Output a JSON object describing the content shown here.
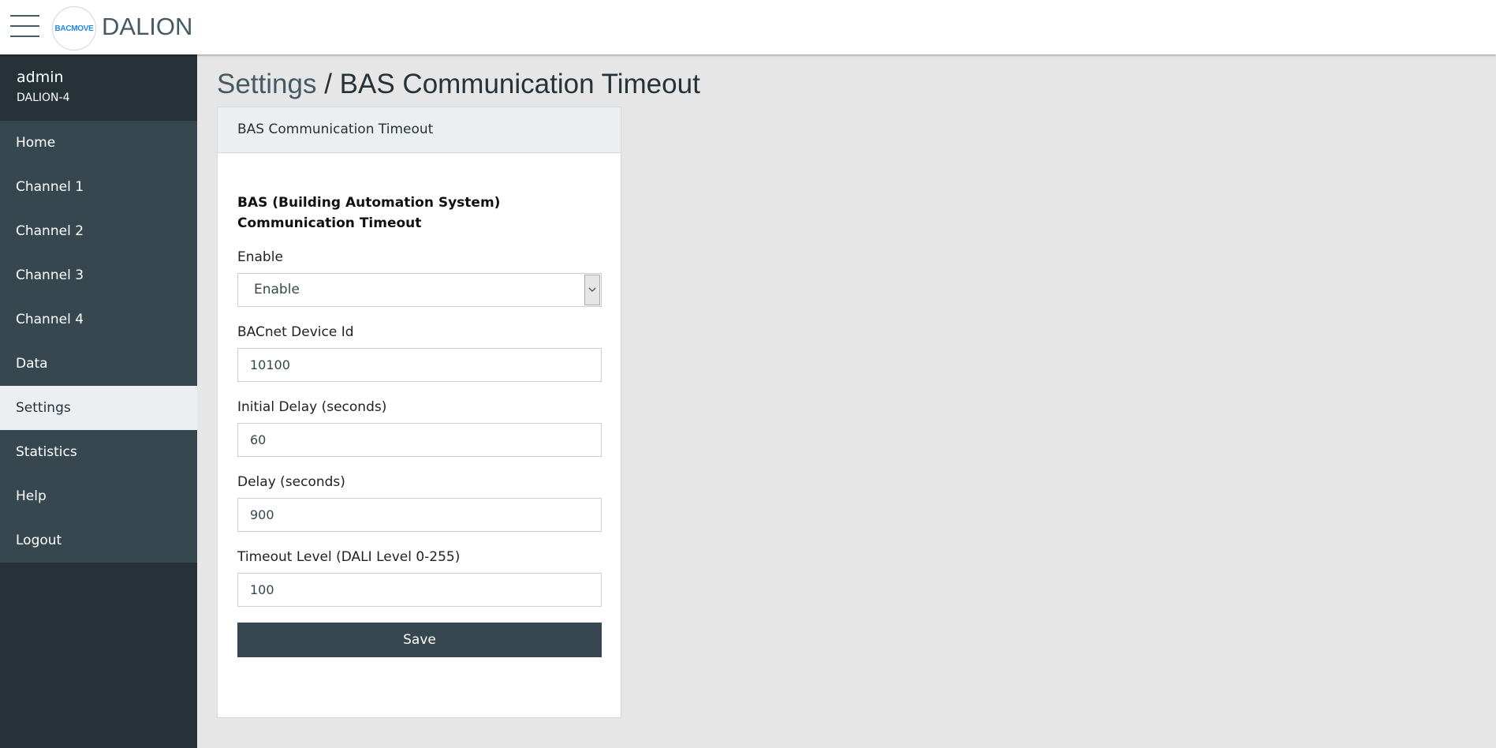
{
  "header": {
    "logo_text": "BACMOVE",
    "brand": "DALION"
  },
  "sidebar": {
    "user": "admin",
    "device": "DALION-4",
    "items": [
      {
        "label": "Home"
      },
      {
        "label": "Channel 1"
      },
      {
        "label": "Channel 2"
      },
      {
        "label": "Channel 3"
      },
      {
        "label": "Channel 4"
      },
      {
        "label": "Data"
      },
      {
        "label": "Settings"
      },
      {
        "label": "Statistics"
      },
      {
        "label": "Help"
      },
      {
        "label": "Logout"
      }
    ],
    "active_item": "Settings"
  },
  "page": {
    "breadcrumb": "Settings",
    "separator": " / ",
    "title": "BAS Communication Timeout"
  },
  "card": {
    "header": "BAS Communication Timeout",
    "section_title": "BAS (Building Automation System) Communication Timeout",
    "enable": {
      "label": "Enable",
      "value": "Enable"
    },
    "device_id": {
      "label": "BACnet Device Id",
      "value": "10100"
    },
    "initial_delay": {
      "label": "Initial Delay (seconds)",
      "value": "60"
    },
    "delay": {
      "label": "Delay (seconds)",
      "value": "900"
    },
    "timeout_level": {
      "label": "Timeout Level (DALI Level 0-255)",
      "value": "100"
    },
    "save_label": "Save"
  },
  "colors": {
    "sidebar_dark": "#263238",
    "sidebar_nav": "#37474f",
    "active_bg": "#eceff1",
    "button": "#37474f",
    "logo_blue": "#1e88e5"
  }
}
